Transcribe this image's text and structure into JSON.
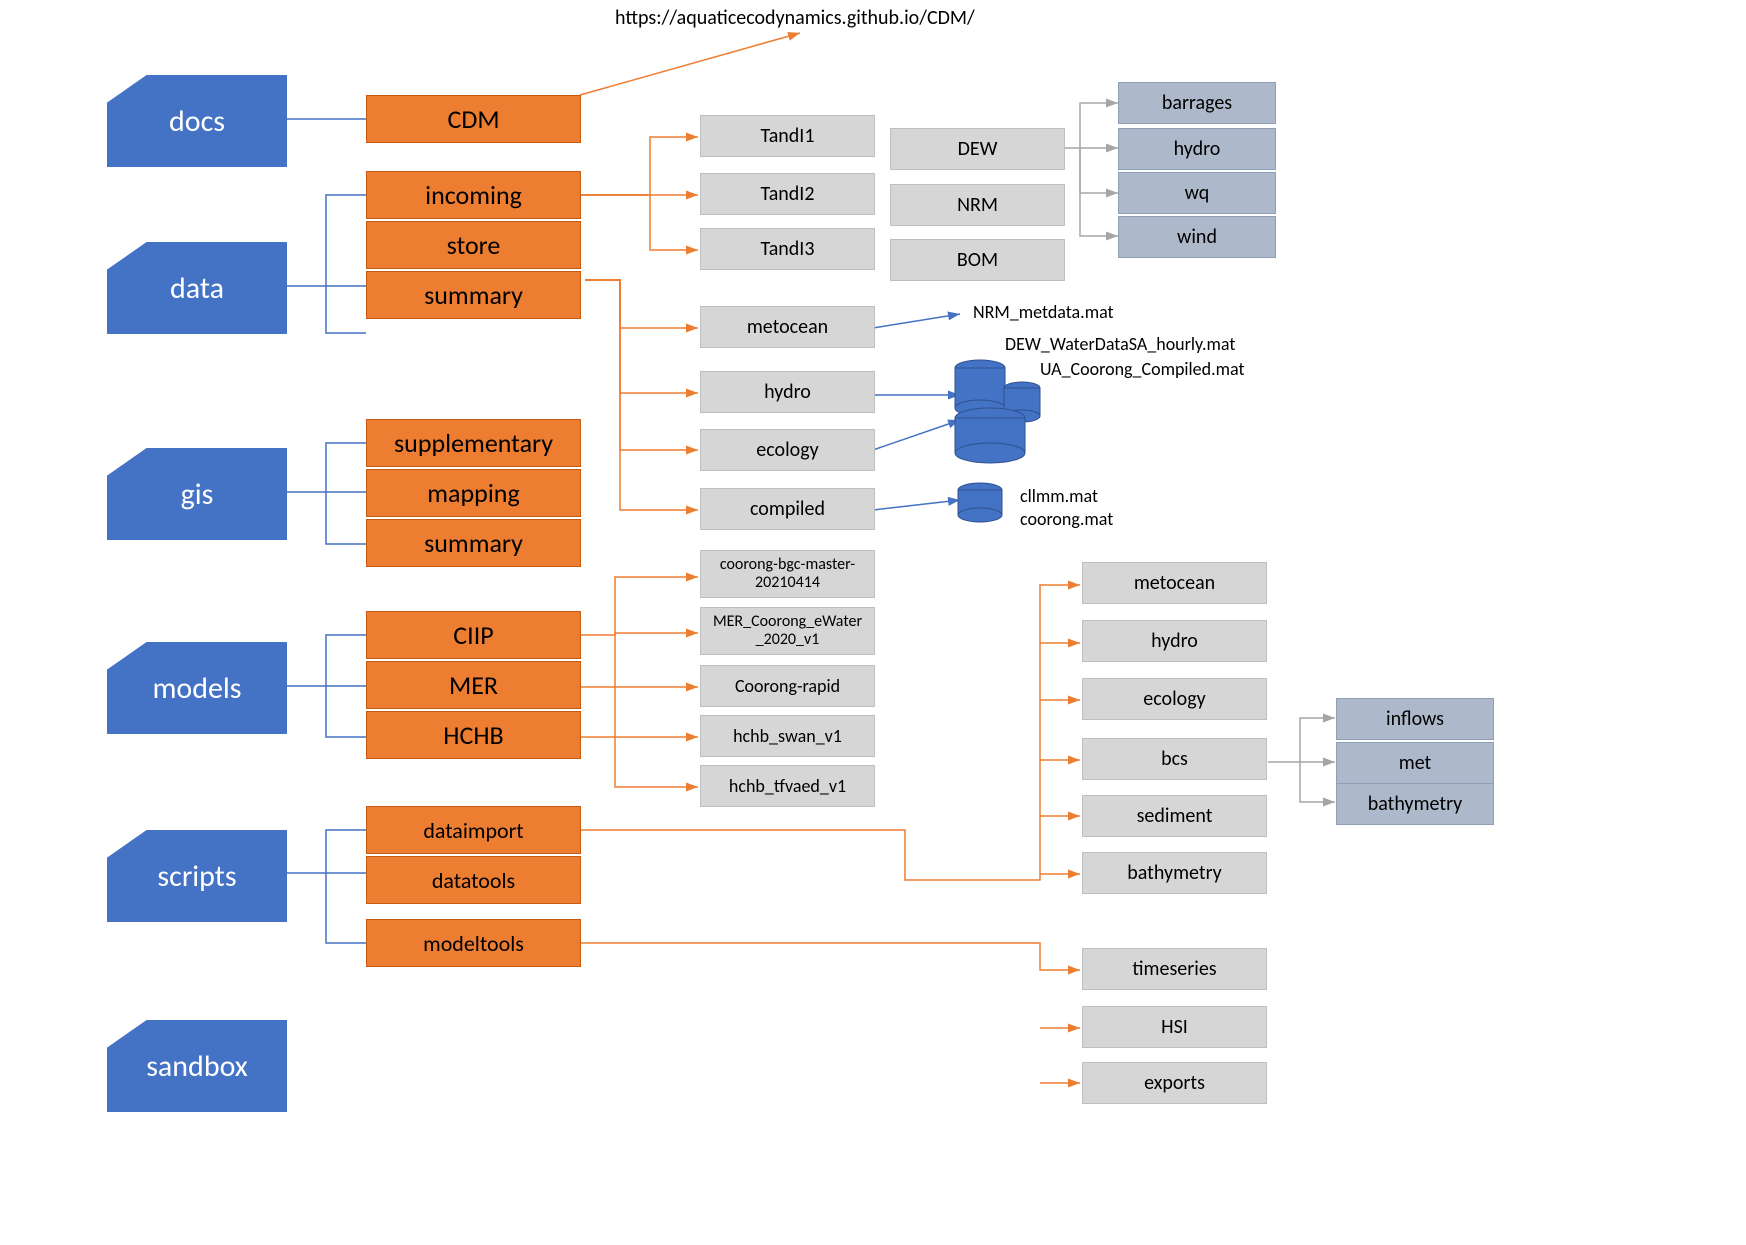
{
  "url": "https://aquaticecodynamics.github.io/CDM/",
  "folders": {
    "docs": "docs",
    "data": "data",
    "gis": "gis",
    "models": "models",
    "scripts": "scripts",
    "sandbox": "sandbox"
  },
  "orange": {
    "cdm": "CDM",
    "incoming": "incoming",
    "store": "store",
    "summary1": "summary",
    "supplementary": "supplementary",
    "mapping": "mapping",
    "summary2": "summary",
    "ciip": "CIIP",
    "mer": "MER",
    "hchb": "HCHB",
    "dataimport": "dataimport",
    "datatools": "datatools",
    "modeltools": "modeltools"
  },
  "grey": {
    "tandi1": "TandI1",
    "tandi2": "TandI2",
    "tandi3": "TandI3",
    "dew": "DEW",
    "nrm": "NRM",
    "bom": "BOM",
    "metocean": "metocean",
    "hydro": "hydro",
    "ecology": "ecology",
    "compiled": "compiled",
    "coorong_bgc_a": "coorong-bgc-master-",
    "coorong_bgc_b": "20210414",
    "mer_coorong_a": "MER_Coorong_eWater",
    "mer_coorong_b": "_2020_v1",
    "coorong_rapid": "Coorong-rapid",
    "hchb_swan": "hchb_swan_v1",
    "hchb_tfvaed": "hchb_tfvaed_v1",
    "metocean2": "metocean",
    "hydro2": "hydro",
    "ecology2": "ecology",
    "bcs": "bcs",
    "sediment": "sediment",
    "bathymetry": "bathymetry",
    "timeseries": "timeseries",
    "hsi": "HSI",
    "exports": "exports"
  },
  "grey2": {
    "barrages": "barrages",
    "hydro": "hydro",
    "wq": "wq",
    "wind": "wind",
    "inflows": "inflows",
    "met": "met",
    "bathymetry": "bathymetry"
  },
  "labels": {
    "nrm_met": "NRM_metdata.mat",
    "dew_water": "DEW_WaterDataSA_hourly.mat",
    "ua_coorong": "UA_Coorong_Compiled.mat",
    "cllmm": "cllmm.mat",
    "coorong": "coorong.mat"
  }
}
